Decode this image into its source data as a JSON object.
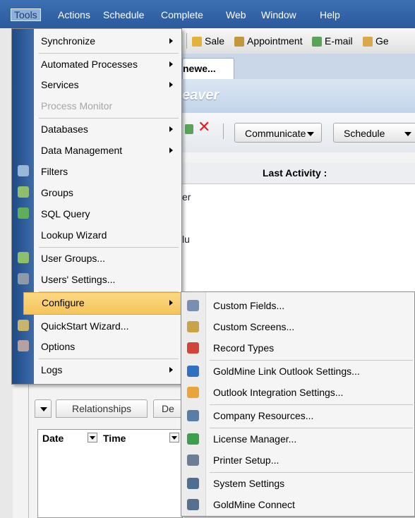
{
  "menubar": {
    "items": [
      "Tools",
      "Actions",
      "Schedule",
      "Complete",
      "Web",
      "Window",
      "Help"
    ]
  },
  "toolbar": {
    "sale": "Sale",
    "appointment": "Appointment",
    "email": "E-mail",
    "ge_fragment": "Ge"
  },
  "tab": {
    "label_fragment": "newe..."
  },
  "banner": {
    "text_fragment": "eaver"
  },
  "actions": {
    "communicate": "Communicate",
    "schedule": "Schedule"
  },
  "grid": {
    "last_activity": "Last Activity :",
    "frag1": "er",
    "frag2": "lu"
  },
  "lower_panel": {
    "tabs": [
      "Relationships",
      "De"
    ],
    "columns": [
      "Date",
      "Time"
    ]
  },
  "tools_menu": {
    "items": [
      {
        "label": "Synchronize",
        "submenu": true
      },
      {
        "label": "Automated Processes",
        "submenu": true
      },
      {
        "label": "Services",
        "submenu": true
      },
      {
        "label": "Process Monitor",
        "disabled": true
      },
      {
        "label": "Databases",
        "submenu": true
      },
      {
        "label": "Data Management",
        "submenu": true
      },
      {
        "label": "Filters",
        "icon": "filter-icon"
      },
      {
        "label": "Groups",
        "icon": "groups-icon"
      },
      {
        "label": "SQL Query",
        "icon": "sql-query-icon"
      },
      {
        "label": "Lookup Wizard"
      },
      {
        "label": "User Groups...",
        "icon": "user-groups-icon"
      },
      {
        "label": "Users' Settings...",
        "icon": "users-settings-icon"
      },
      {
        "label": "Configure",
        "submenu": true,
        "highlighted": true
      },
      {
        "label": "QuickStart Wizard...",
        "icon": "wizard-icon"
      },
      {
        "label": "Options",
        "icon": "options-icon"
      },
      {
        "label": "Logs",
        "submenu": true
      }
    ]
  },
  "configure_menu": {
    "items": [
      {
        "label": "Custom Fields...",
        "icon": "custom-fields-icon",
        "color": "#7a8fb0"
      },
      {
        "label": "Custom Screens...",
        "icon": "custom-screens-icon",
        "color": "#c9a24a"
      },
      {
        "label": "Record Types",
        "icon": "record-types-icon",
        "color": "#d0443a"
      },
      {
        "label": "GoldMine Link Outlook Settings...",
        "icon": "outlook-link-icon",
        "color": "#2f6fc4"
      },
      {
        "label": "Outlook Integration Settings...",
        "icon": "outlook-integration-icon",
        "color": "#e8a53a"
      },
      {
        "label": "Company Resources...",
        "icon": "company-resources-icon",
        "color": "#5a7da8"
      },
      {
        "label": "License Manager...",
        "icon": "license-manager-icon",
        "color": "#3f9d4e"
      },
      {
        "label": "Printer Setup...",
        "icon": "printer-icon",
        "color": "#6c7e95"
      },
      {
        "label": "System Settings",
        "icon": "system-settings-icon",
        "color": "#4e6f8f"
      },
      {
        "label": "GoldMine Connect",
        "icon": "goldmine-connect-icon",
        "color": "#58708f"
      }
    ]
  }
}
